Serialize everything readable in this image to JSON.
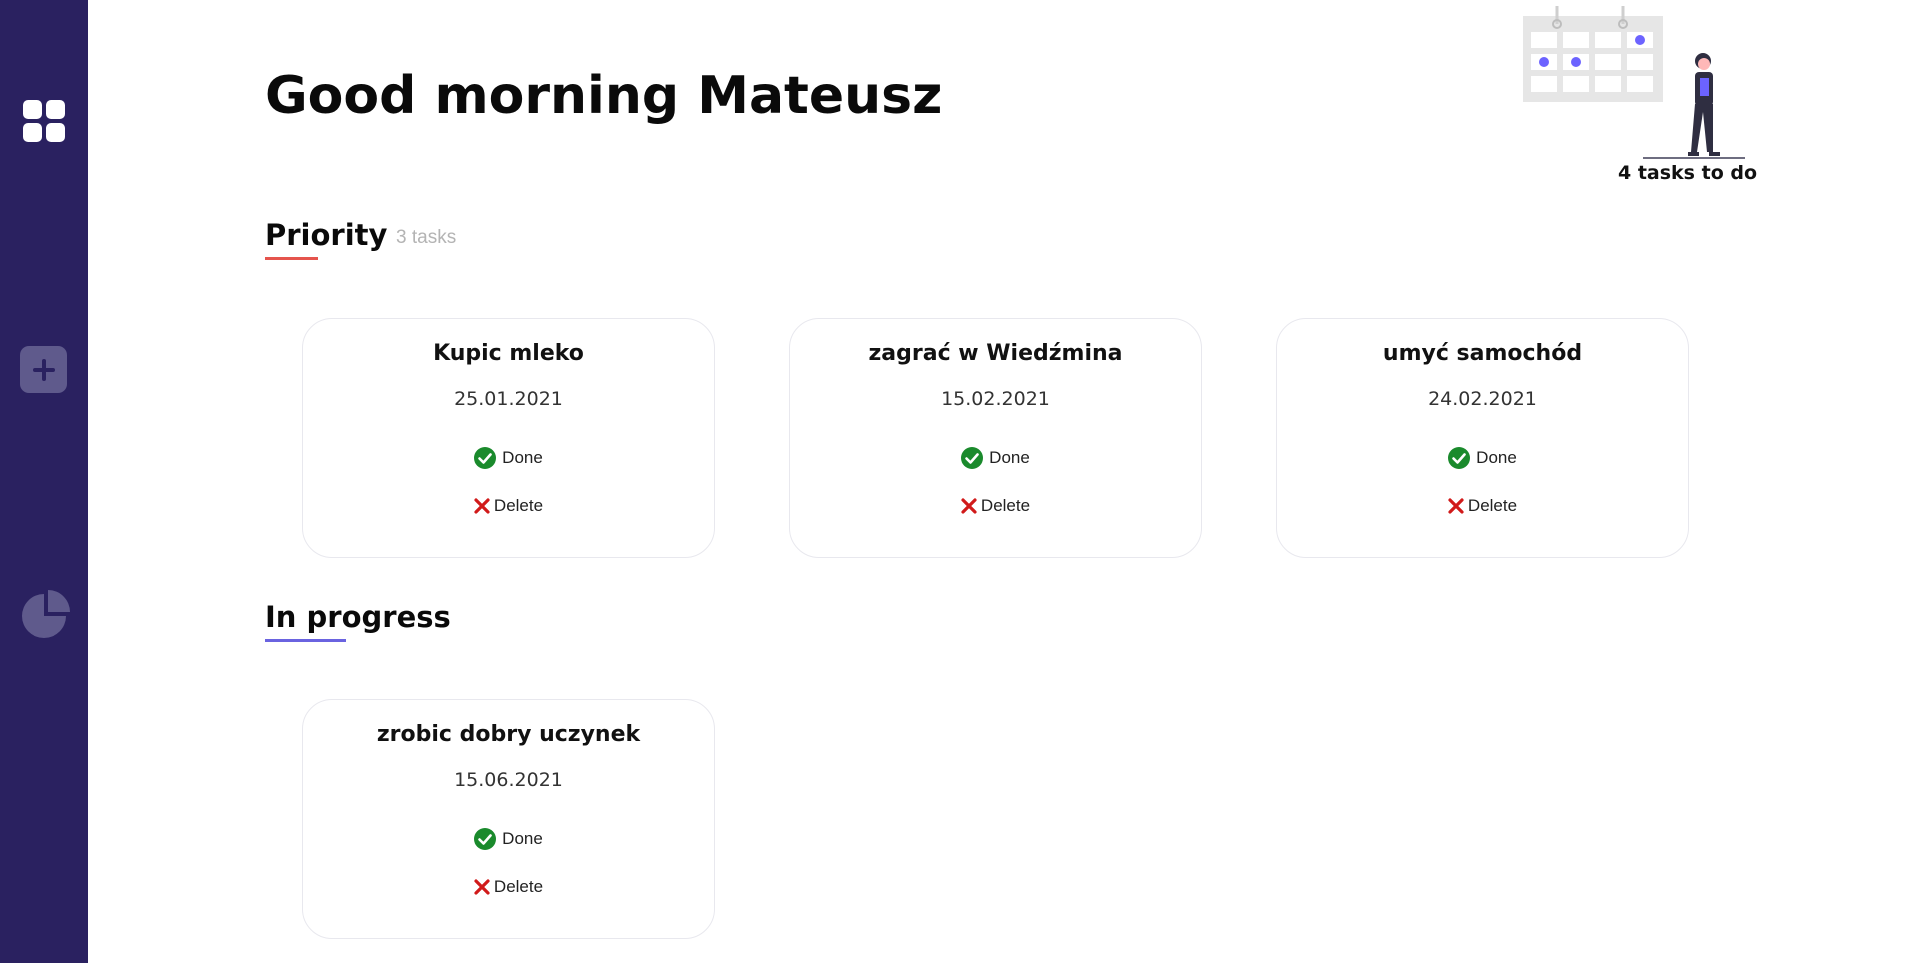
{
  "sidebar": {
    "items": [
      {
        "icon": "dashboard-grid-icon"
      },
      {
        "icon": "plus-icon"
      },
      {
        "icon": "pie-chart-icon"
      }
    ],
    "background": "#2a2160"
  },
  "header": {
    "greeting": "Good morning Mateusz",
    "summary": "4 tasks to do"
  },
  "sections": [
    {
      "title": "Priority",
      "count_label": "3 tasks",
      "accent": "#e5544d",
      "tasks": [
        {
          "title": "Kupic mleko",
          "date": "25.01.2021",
          "done_label": "Done",
          "delete_label": "Delete"
        },
        {
          "title": "zagrać w Wiedźmina",
          "date": "15.02.2021",
          "done_label": "Done",
          "delete_label": "Delete"
        },
        {
          "title": "umyć samochód",
          "date": "24.02.2021",
          "done_label": "Done",
          "delete_label": "Delete"
        }
      ]
    },
    {
      "title": "In progress",
      "accent": "#6a63e0",
      "tasks": [
        {
          "title": "zrobic dobry uczynek",
          "date": "15.06.2021",
          "done_label": "Done",
          "delete_label": "Delete"
        }
      ]
    }
  ],
  "colors": {
    "done": "#1a8a2c",
    "delete": "#d11a1a",
    "illustration_accent": "#6c63ff"
  }
}
